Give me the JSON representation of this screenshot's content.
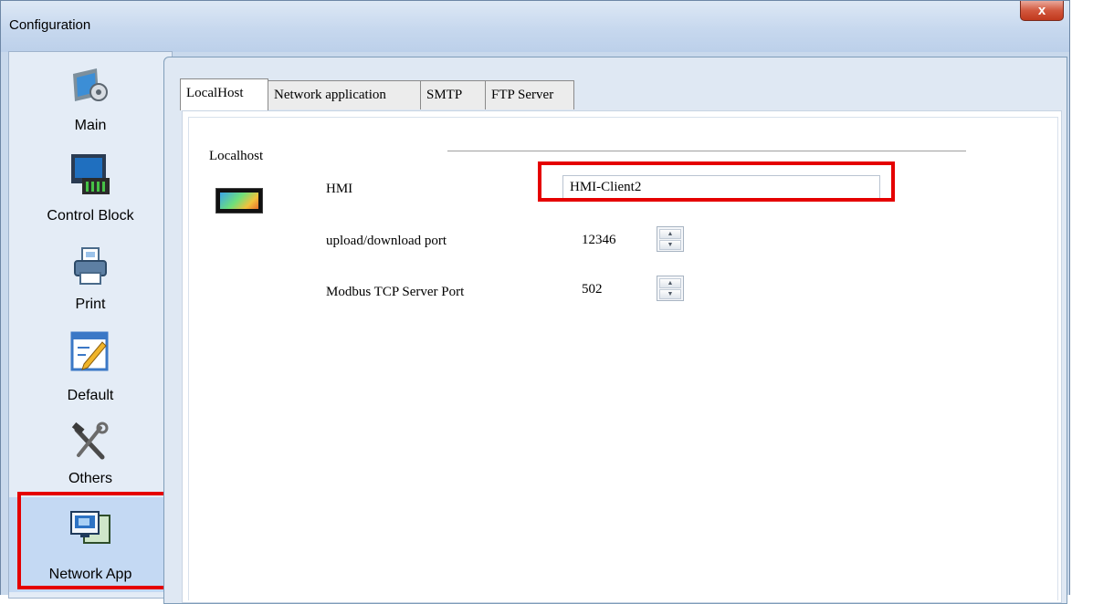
{
  "window": {
    "title": "Configuration",
    "close_glyph": "x"
  },
  "sidebar": {
    "items": [
      {
        "label": "Main",
        "icon": "main-settings-icon"
      },
      {
        "label": "Control Block",
        "icon": "control-block-icon"
      },
      {
        "label": "Print",
        "icon": "printer-icon"
      },
      {
        "label": "Default",
        "icon": "default-edit-icon"
      },
      {
        "label": "Others",
        "icon": "tools-icon"
      },
      {
        "label": "Network App",
        "icon": "network-app-icon"
      }
    ],
    "selected": "Network App"
  },
  "tabs": [
    {
      "label": "LocalHost",
      "active": true
    },
    {
      "label": "Network application",
      "active": false
    },
    {
      "label": "SMTP",
      "active": false
    },
    {
      "label": "FTP Server",
      "active": false
    }
  ],
  "localhost": {
    "group_label": "Localhost",
    "hmi_label": "HMI",
    "hmi_value": "HMI-Client2",
    "upload_port_label": "upload/download port",
    "upload_port_value": "12346",
    "modbus_port_label": "Modbus TCP  Server Port",
    "modbus_port_value": "502"
  },
  "colors": {
    "highlight": "#e50000",
    "close_button": "#c1391d",
    "window_frame": "#c9d9ec"
  }
}
